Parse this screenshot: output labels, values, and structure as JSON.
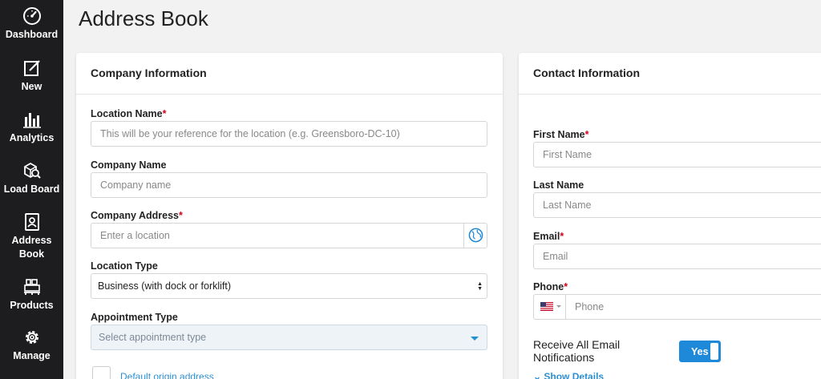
{
  "sidebar": {
    "items": [
      {
        "label": "Dashboard",
        "icon": "dashboard-gauge-icon"
      },
      {
        "label": "New",
        "icon": "new-edit-icon"
      },
      {
        "label": "Analytics",
        "icon": "analytics-bar-icon"
      },
      {
        "label": "Load Board",
        "icon": "load-board-icon"
      },
      {
        "label": "Address Book",
        "icon": "address-book-icon"
      },
      {
        "label": "Products",
        "icon": "products-pallet-icon"
      },
      {
        "label": "Manage",
        "icon": "manage-gear-icon"
      }
    ]
  },
  "page": {
    "title": "Address Book"
  },
  "company": {
    "header": "Company Information",
    "location_name_label": "Location Name",
    "location_name_placeholder": "This will be your reference for the location (e.g. Greensboro-DC-10)",
    "company_name_label": "Company Name",
    "company_name_placeholder": "Company name",
    "company_address_label": "Company Address",
    "company_address_placeholder": "Enter a location",
    "location_type_label": "Location Type",
    "location_type_value": "Business (with dock or forklift)",
    "appointment_type_label": "Appointment Type",
    "appointment_type_placeholder": "Select appointment type",
    "default_origin_label": "Default origin address"
  },
  "contact": {
    "header": "Contact Information",
    "first_name_label": "First Name",
    "first_name_placeholder": "First Name",
    "last_name_label": "Last Name",
    "last_name_placeholder": "Last Name",
    "email_label": "Email",
    "email_placeholder": "Email",
    "phone_label": "Phone",
    "phone_placeholder": "Phone",
    "notifications_label": "Receive All Email Notifications",
    "notifications_toggle": "Yes",
    "show_details": "Show Details"
  },
  "required_mark": "*",
  "colors": {
    "sidebar_bg": "#1d1d1f",
    "accent": "#1e88d9",
    "required": "#d0021b",
    "page_bg": "#f2f2f2"
  }
}
